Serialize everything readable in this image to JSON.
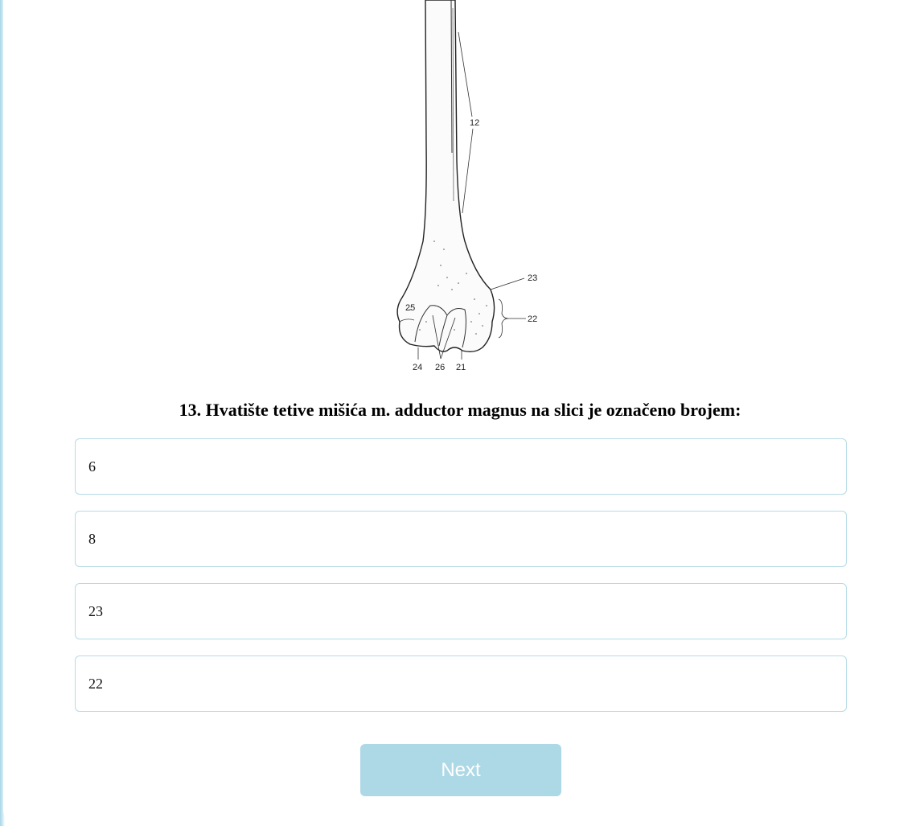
{
  "figure": {
    "labels": {
      "l12": "12",
      "l23": "23",
      "l22": "22",
      "l25": "25",
      "l24": "24",
      "l26": "26",
      "l21": "21"
    }
  },
  "question": {
    "text": "13. Hvatište tetive mišića m. adductor magnus na slici je označeno brojem:"
  },
  "options": [
    {
      "label": "6"
    },
    {
      "label": "8"
    },
    {
      "label": "23"
    },
    {
      "label": "22"
    }
  ],
  "next_button": {
    "label": "Next"
  }
}
